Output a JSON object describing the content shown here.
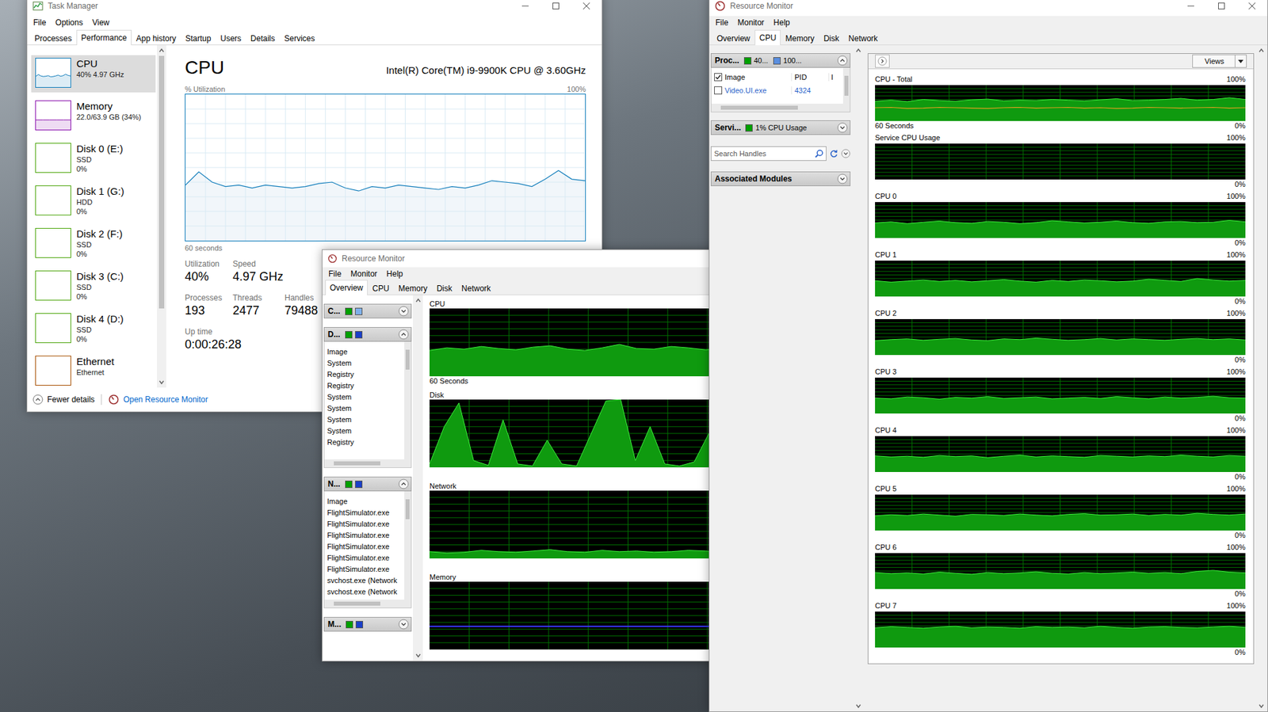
{
  "task_manager": {
    "title": "Task Manager",
    "menu": [
      "File",
      "Options",
      "View"
    ],
    "tabs": [
      {
        "label": "Processes",
        "selected": false
      },
      {
        "label": "Performance",
        "selected": true
      },
      {
        "label": "App history",
        "selected": false
      },
      {
        "label": "Startup",
        "selected": false
      },
      {
        "label": "Users",
        "selected": false
      },
      {
        "label": "Details",
        "selected": false
      },
      {
        "label": "Services",
        "selected": false
      }
    ],
    "sidebar": {
      "items": [
        {
          "name": "CPU",
          "details": [
            "40% 4.97 GHz"
          ],
          "selected": true,
          "color": "#117dbb",
          "values": [
            38,
            44,
            39,
            37,
            38,
            40,
            36,
            37,
            39,
            42,
            38,
            40,
            45,
            41,
            39
          ]
        },
        {
          "name": "Memory",
          "details": [
            "22.0/63.9 GB (34%)"
          ],
          "selected": false,
          "color": "#8b12ae",
          "values": [
            34,
            34,
            34,
            34,
            34,
            34
          ]
        },
        {
          "name": "Disk 0 (E:)",
          "details": [
            "SSD",
            "0%"
          ],
          "selected": false,
          "color": "#4da60c",
          "values": []
        },
        {
          "name": "Disk 1 (G:)",
          "details": [
            "HDD",
            "0%"
          ],
          "selected": false,
          "color": "#4da60c",
          "values": []
        },
        {
          "name": "Disk 2 (F:)",
          "details": [
            "SSD",
            "0%"
          ],
          "selected": false,
          "color": "#4da60c",
          "values": []
        },
        {
          "name": "Disk 3 (C:)",
          "details": [
            "SSD",
            "0%"
          ],
          "selected": false,
          "color": "#4da60c",
          "values": []
        },
        {
          "name": "Disk 4 (D:)",
          "details": [
            "SSD",
            "0%"
          ],
          "selected": false,
          "color": "#4da60c",
          "values": []
        },
        {
          "name": "Ethernet",
          "details": [
            "Ethernet"
          ],
          "selected": false,
          "color": "#a74f01",
          "values": []
        }
      ]
    },
    "cpu_panel": {
      "title": "CPU",
      "model": "Intel(R) Core(TM) i9-9900K CPU @ 3.60GHz",
      "axis_label": "% Utilization",
      "max_label": "100%",
      "time_label": "60 seconds",
      "values": [
        38,
        47,
        40,
        37,
        38,
        36,
        38,
        37,
        36,
        37,
        39,
        40,
        36,
        34,
        37,
        36,
        38,
        37,
        36,
        35,
        37,
        36,
        38,
        41,
        40,
        39,
        37,
        42,
        48,
        42,
        41
      ],
      "stats": [
        [
          {
            "label": "Utilization",
            "value": "40%"
          },
          {
            "label": "Speed",
            "value": "4.97 GHz"
          }
        ],
        [
          {
            "label": "Processes",
            "value": "193"
          },
          {
            "label": "Threads",
            "value": "2477"
          },
          {
            "label": "Handles",
            "value": "79488"
          }
        ],
        [
          {
            "label": "Up time",
            "value": "0:00:26:28"
          }
        ]
      ]
    },
    "footer": {
      "fewer_details": "Fewer details",
      "open_resource_monitor": "Open Resource Monitor"
    }
  },
  "resource_monitor_overview": {
    "title": "Resource Monitor",
    "menu": [
      "File",
      "Monitor",
      "Help"
    ],
    "tabs": [
      {
        "label": "Overview",
        "selected": true
      },
      {
        "label": "CPU",
        "selected": false
      },
      {
        "label": "Memory",
        "selected": false
      },
      {
        "label": "Disk",
        "selected": false
      },
      {
        "label": "Network",
        "selected": false
      }
    ],
    "sections": [
      {
        "label": "C...",
        "expanded": false,
        "colors": [
          "#00a000",
          "#7fb0ea"
        ],
        "header": "",
        "rows": []
      },
      {
        "label": "D...",
        "expanded": true,
        "colors": [
          "#00a000",
          "#1a3fc8"
        ],
        "header": "Image",
        "rows": [
          "System",
          "Registry",
          "Registry",
          "System",
          "System",
          "System",
          "System",
          "Registry"
        ]
      },
      {
        "label": "N...",
        "expanded": true,
        "colors": [
          "#00a000",
          "#1a3fc8"
        ],
        "header": "Image",
        "rows": [
          "FlightSimulator.exe",
          "FlightSimulator.exe",
          "FlightSimulator.exe",
          "FlightSimulator.exe",
          "FlightSimulator.exe",
          "FlightSimulator.exe",
          "svchost.exe (Network",
          "svchost.exe (Network"
        ]
      },
      {
        "label": "M...",
        "expanded": false,
        "colors": [
          "#00a000",
          "#1a3fc8"
        ],
        "header": "",
        "rows": []
      }
    ],
    "graphs": [
      {
        "title": "CPU",
        "caption": "60 Seconds",
        "kind": "area",
        "values": [
          38,
          42,
          40,
          44,
          41,
          39,
          43,
          45,
          40,
          38,
          42,
          47,
          41,
          40,
          44,
          42,
          39,
          41,
          45,
          43,
          40,
          42,
          44,
          41
        ]
      },
      {
        "title": "Disk",
        "caption": "",
        "kind": "area",
        "values": [
          5,
          60,
          95,
          10,
          3,
          70,
          5,
          2,
          40,
          5,
          2,
          50,
          98,
          100,
          10,
          60,
          5,
          2,
          8,
          50,
          3,
          45,
          98,
          10,
          2,
          3,
          40,
          5
        ]
      },
      {
        "title": "Network",
        "caption": "",
        "kind": "area",
        "values": [
          10,
          8,
          9,
          12,
          10,
          9,
          11,
          13,
          10,
          9,
          12,
          10,
          11,
          9,
          10,
          12,
          11,
          9,
          10,
          11,
          13,
          10,
          9,
          11
        ]
      },
      {
        "title": "Memory",
        "caption": "",
        "kind": "line",
        "values": [
          34,
          34,
          34,
          34,
          34,
          34,
          34,
          34,
          34,
          34,
          34,
          34
        ]
      }
    ]
  },
  "resource_monitor_cpu": {
    "title": "Resource Monitor",
    "menu": [
      "File",
      "Monitor",
      "Help"
    ],
    "tabs": [
      {
        "label": "Overview",
        "selected": false
      },
      {
        "label": "CPU",
        "selected": true
      },
      {
        "label": "Memory",
        "selected": false
      },
      {
        "label": "Disk",
        "selected": false
      },
      {
        "label": "Network",
        "selected": false
      }
    ],
    "processes": {
      "label": "Proc...",
      "usage": "40...",
      "max_frequency": "100...",
      "expanded": true,
      "columns": [
        {
          "label": "Image",
          "checked": true
        },
        {
          "label": "PID"
        },
        {
          "label": "I"
        }
      ],
      "rows": [
        {
          "image": "Video.UI.exe",
          "pid": "4324",
          "checked": false
        }
      ]
    },
    "services": {
      "label": "Servi...",
      "usage": "1% CPU Usage",
      "expanded": false
    },
    "handles": {
      "placeholder": "Search Handles"
    },
    "modules": {
      "label": "Associated Modules",
      "expanded": false
    },
    "views": "Views",
    "graphs": [
      {
        "title": "CPU - Total",
        "max": "100%",
        "min": "0%",
        "caption": "60 Seconds",
        "values": [
          55,
          58,
          54,
          60,
          57,
          55,
          59,
          61,
          56,
          58,
          57,
          60,
          58,
          56,
          59,
          62,
          57,
          58,
          60,
          63,
          58,
          60,
          65,
          60
        ],
        "frequency": [
          37,
          38,
          35,
          36,
          38,
          37,
          36,
          35,
          37,
          38,
          36,
          37,
          38,
          36,
          37,
          35,
          36,
          38,
          37,
          36,
          37,
          38,
          36,
          37
        ]
      },
      {
        "title": "Service CPU Usage",
        "max": "100%",
        "min": "0%",
        "caption": "",
        "values": [],
        "frequency": []
      },
      {
        "title": "CPU 0",
        "max": "100%",
        "min": "0%",
        "caption": "",
        "values": [
          42,
          45,
          40,
          44,
          47,
          43,
          41,
          46,
          44,
          40,
          43,
          48,
          45,
          42,
          44,
          47,
          43,
          41,
          45,
          46,
          43,
          44,
          49,
          45
        ],
        "frequency": []
      },
      {
        "title": "CPU 1",
        "max": "100%",
        "min": "0%",
        "caption": "",
        "values": [
          44,
          40,
          43,
          46,
          42,
          45,
          41,
          44,
          47,
          43,
          40,
          45,
          42,
          46,
          44,
          41,
          43,
          48,
          45,
          42,
          50,
          46,
          43,
          45
        ],
        "frequency": []
      },
      {
        "title": "CPU 2",
        "max": "100%",
        "min": "0%",
        "caption": "",
        "values": [
          40,
          43,
          45,
          41,
          44,
          46,
          42,
          40,
          45,
          43,
          47,
          44,
          41,
          43,
          46,
          42,
          45,
          43,
          41,
          44,
          46,
          43,
          45,
          42
        ],
        "frequency": []
      },
      {
        "title": "CPU 3",
        "max": "100%",
        "min": "0%",
        "caption": "",
        "values": [
          43,
          41,
          46,
          44,
          40,
          45,
          43,
          47,
          42,
          44,
          46,
          41,
          43,
          45,
          42,
          47,
          44,
          41,
          46,
          43,
          45,
          48,
          44,
          43
        ],
        "frequency": []
      },
      {
        "title": "CPU 4",
        "max": "100%",
        "min": "0%",
        "caption": "",
        "values": [
          45,
          42,
          44,
          41,
          46,
          43,
          45,
          40,
          44,
          47,
          42,
          45,
          43,
          41,
          46,
          44,
          42,
          45,
          43,
          47,
          44,
          42,
          46,
          44
        ],
        "frequency": []
      },
      {
        "title": "CPU 5",
        "max": "100%",
        "min": "0%",
        "caption": "",
        "values": [
          41,
          44,
          42,
          46,
          43,
          40,
          45,
          44,
          42,
          46,
          43,
          41,
          45,
          47,
          43,
          44,
          46,
          42,
          45,
          43,
          48,
          45,
          43,
          46
        ],
        "frequency": []
      },
      {
        "title": "CPU 6",
        "max": "100%",
        "min": "0%",
        "caption": "",
        "values": [
          46,
          43,
          45,
          42,
          47,
          44,
          41,
          46,
          43,
          45,
          48,
          44,
          42,
          46,
          43,
          45,
          47,
          44,
          46,
          43,
          49,
          52,
          47,
          45
        ],
        "frequency": []
      },
      {
        "title": "CPU 7",
        "max": "100%",
        "min": "0%",
        "caption": "",
        "values": [
          55,
          58,
          56,
          54,
          57,
          59,
          55,
          57,
          56,
          54,
          58,
          56,
          57,
          55,
          59,
          56,
          54,
          57,
          58,
          56,
          55,
          57,
          59,
          56
        ],
        "frequency": []
      }
    ]
  }
}
